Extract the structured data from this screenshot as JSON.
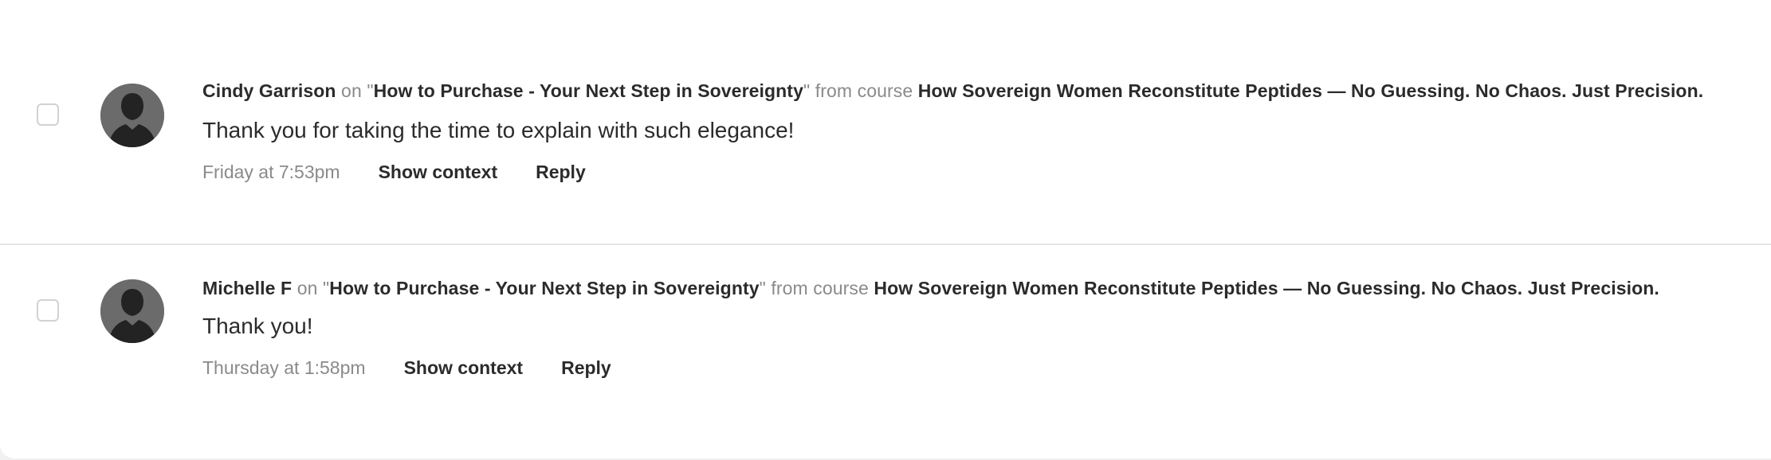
{
  "comments": [
    {
      "author": "Cindy Garrison",
      "on_text": "on",
      "lesson": "How to Purchase - Your Next Step in Sovereignty",
      "from_text": "from course",
      "course": "How Sovereign Women Reconstitute Peptides — No Guessing. No Chaos. Just Precision.",
      "body": "Thank you for taking the time to explain with such elegance!",
      "timestamp": "Friday at 7:53pm",
      "show_context_label": "Show context",
      "reply_label": "Reply",
      "avatar_icon": "default-user-silhouette-icon"
    },
    {
      "author": "Michelle F",
      "on_text": "on",
      "lesson": "How to Purchase - Your Next Step in Sovereignty",
      "from_text": "from course",
      "course": "How Sovereign Women Reconstitute Peptides — No Guessing. No Chaos. Just Precision.",
      "body": "Thank you!",
      "timestamp": "Thursday at 1:58pm",
      "show_context_label": "Show context",
      "reply_label": "Reply",
      "avatar_icon": "default-user-silhouette-icon"
    }
  ],
  "colors": {
    "text": "#2b2b2b",
    "muted": "#8a8a8a",
    "divider": "#e6e6e6",
    "avatar_bg": "#6b6b6b"
  }
}
